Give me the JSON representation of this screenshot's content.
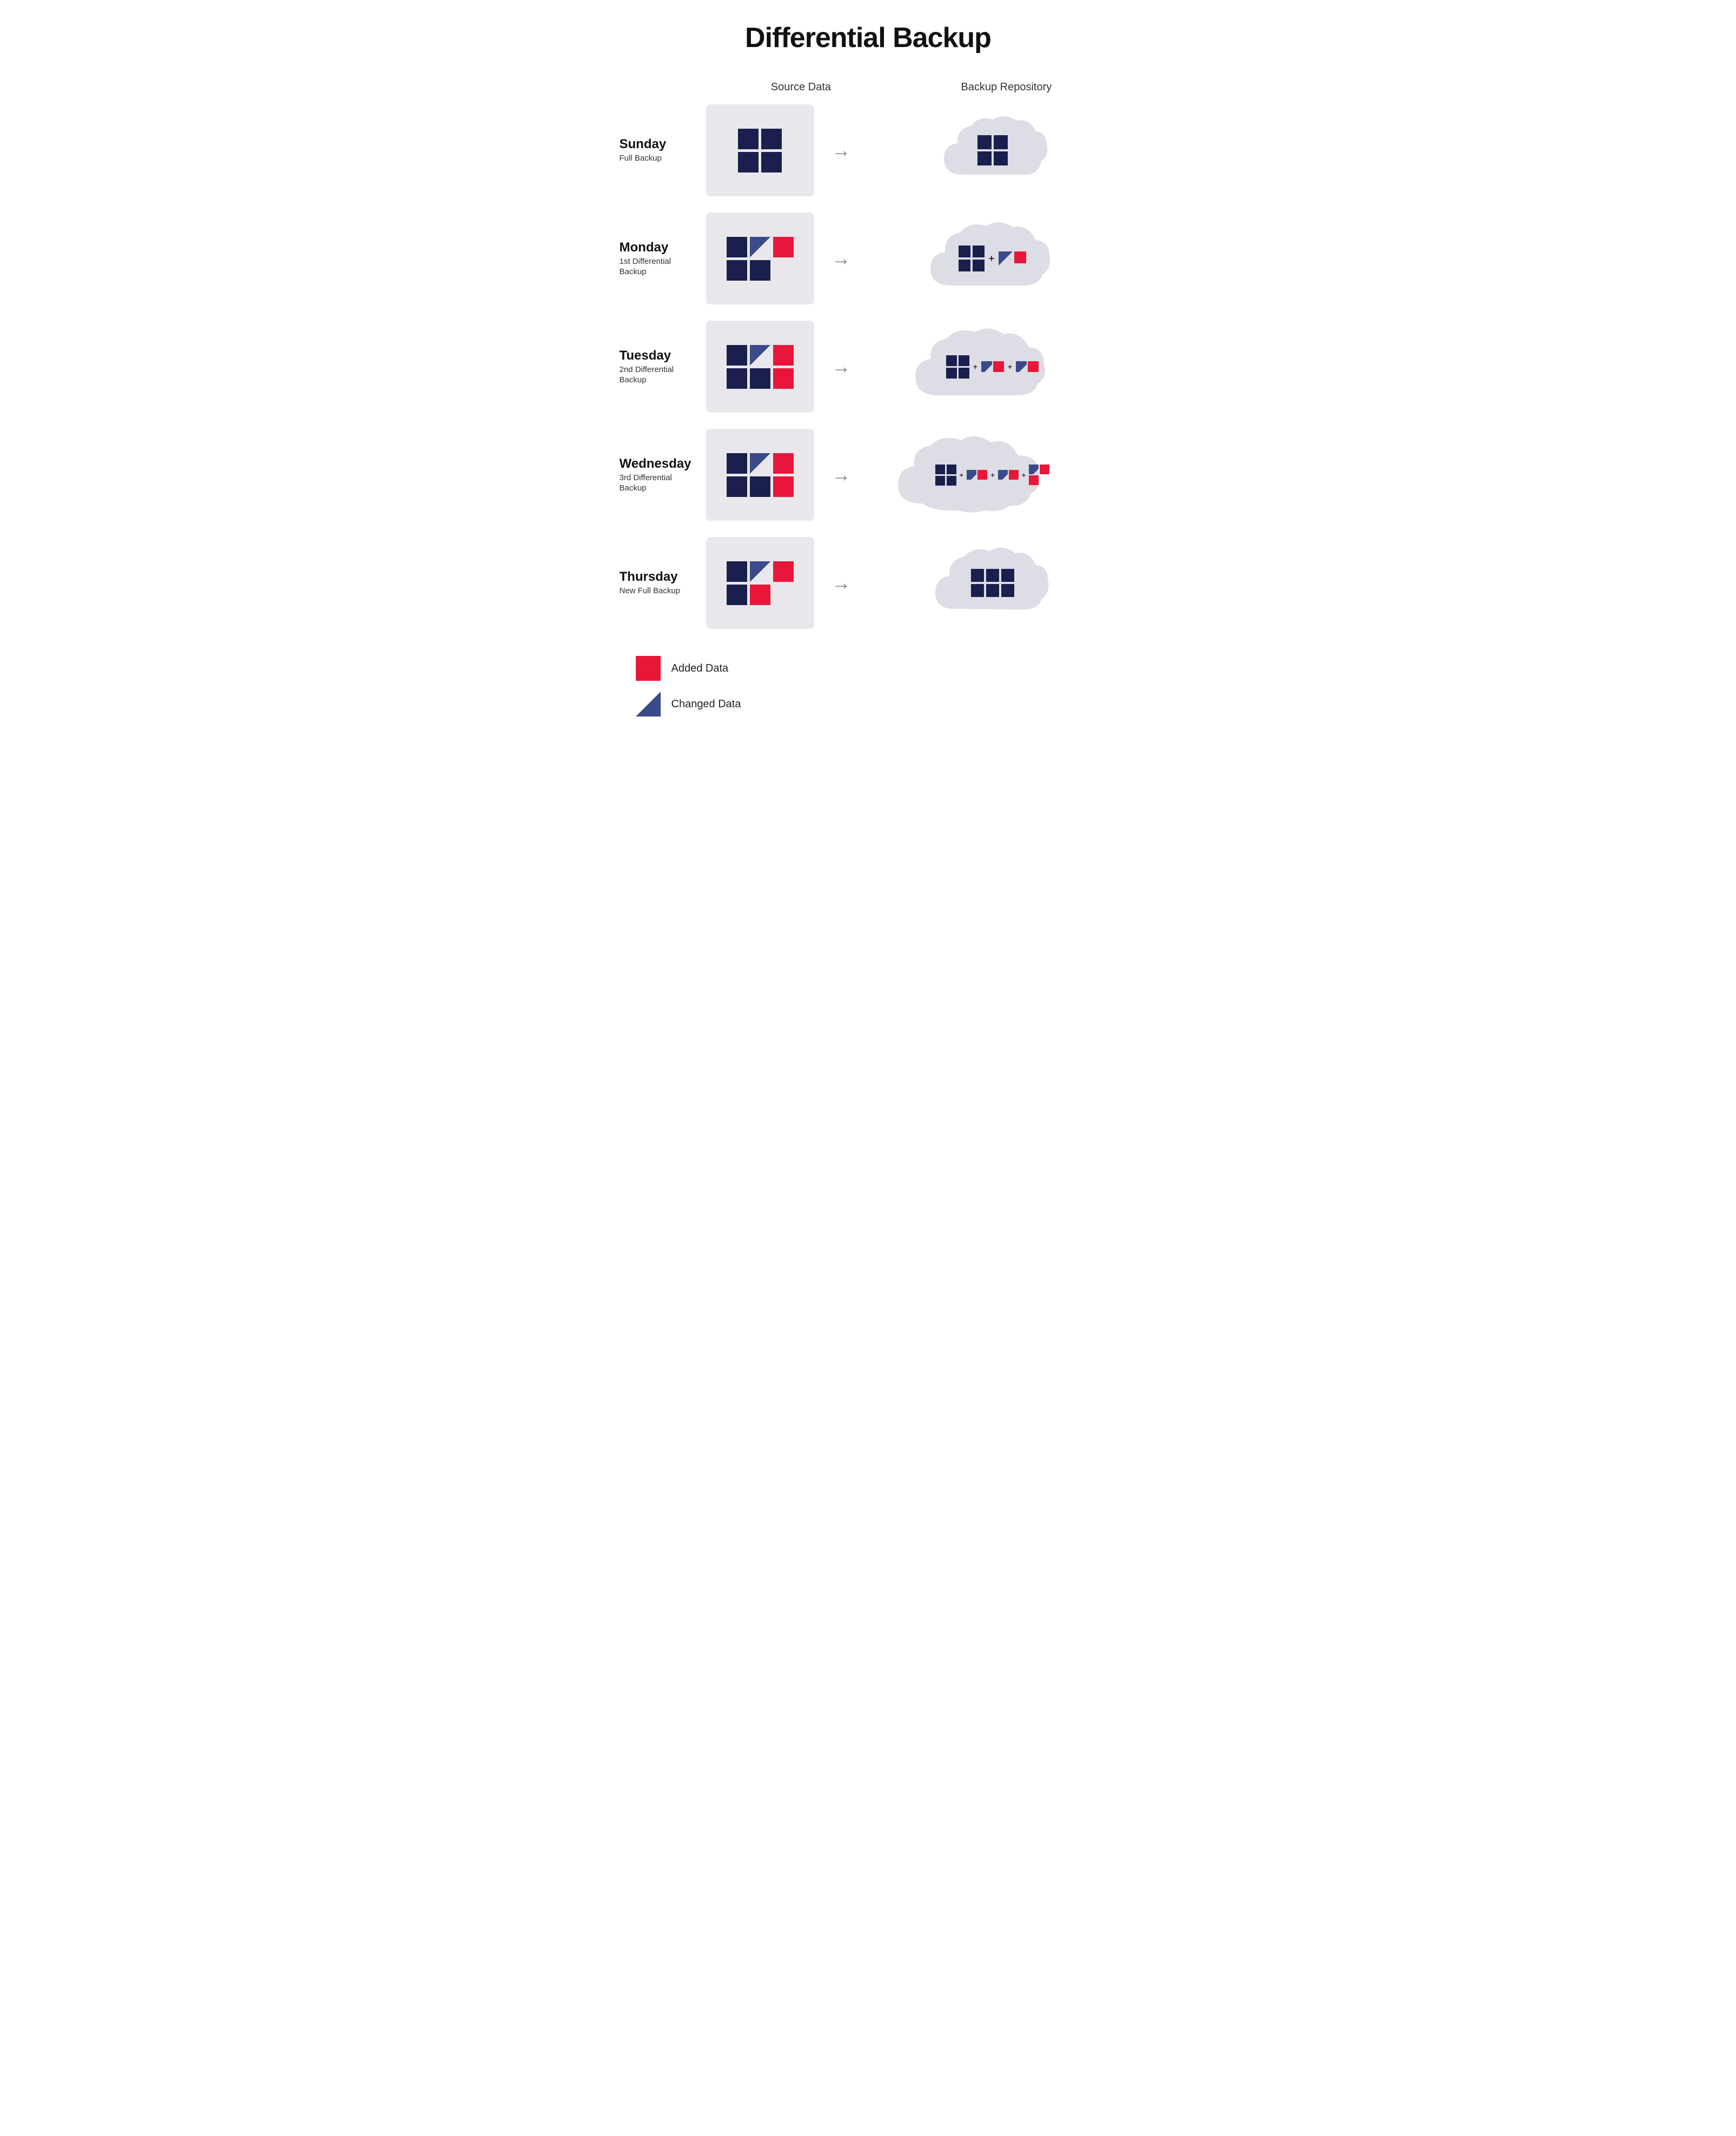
{
  "title": "Differential Backup",
  "columns": {
    "source": "Source Data",
    "repo": "Backup Repository"
  },
  "rows": [
    {
      "day": "Sunday",
      "subtitle": "Full Backup",
      "type": "full"
    },
    {
      "day": "Monday",
      "subtitle": "1st Differential Backup",
      "type": "diff1"
    },
    {
      "day": "Tuesday",
      "subtitle": "2nd Differential Backup",
      "type": "diff2"
    },
    {
      "day": "Wednesday",
      "subtitle": "3rd Differential Backup",
      "type": "diff3"
    },
    {
      "day": "Thursday",
      "subtitle": "New Full Backup",
      "type": "full2"
    }
  ],
  "legend": {
    "added": "Added Data",
    "changed": "Changed Data"
  }
}
